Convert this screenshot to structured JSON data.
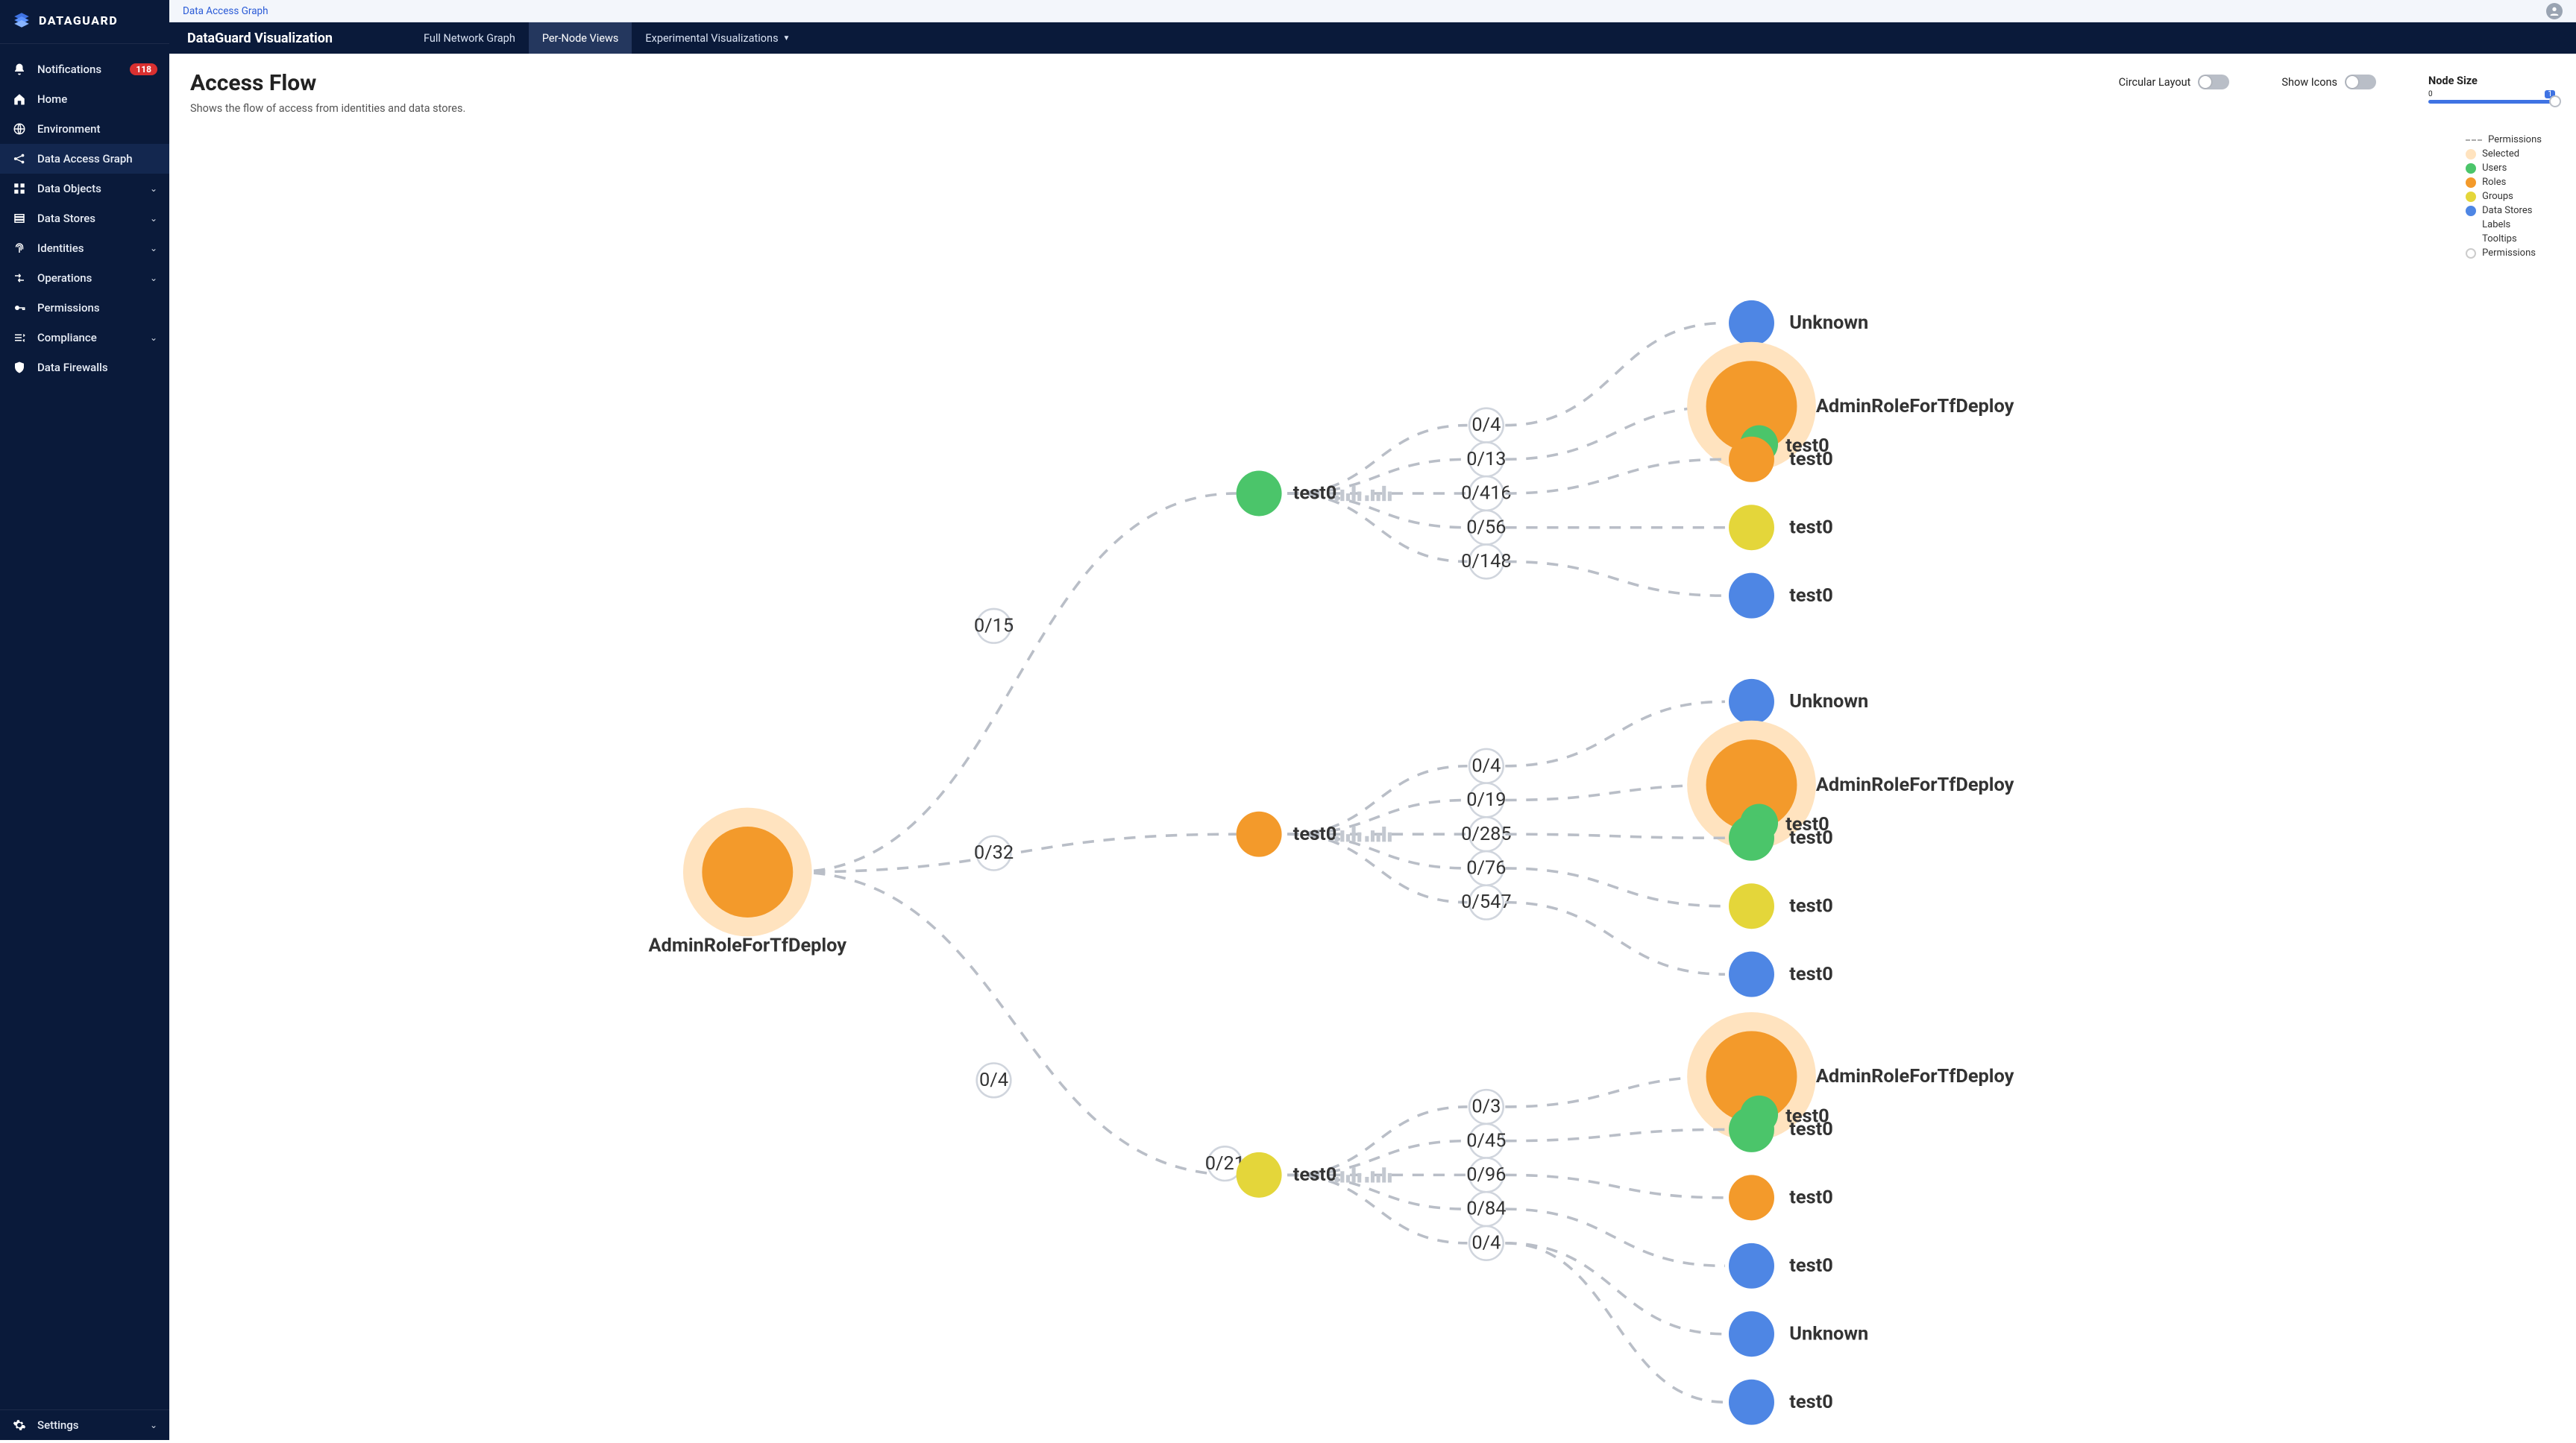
{
  "brand": {
    "name": "DATAGUARD"
  },
  "breadcrumb": {
    "label": "Data Access Graph"
  },
  "sidebar": {
    "items": [
      {
        "label": "Notifications",
        "icon": "bell",
        "badge": "118"
      },
      {
        "label": "Home",
        "icon": "home"
      },
      {
        "label": "Environment",
        "icon": "globe"
      },
      {
        "label": "Data Access Graph",
        "icon": "graph",
        "active": true
      },
      {
        "label": "Data Objects",
        "icon": "objects",
        "caret": true
      },
      {
        "label": "Data Stores",
        "icon": "stores",
        "caret": true
      },
      {
        "label": "Identities",
        "icon": "fingerprint",
        "caret": true
      },
      {
        "label": "Operations",
        "icon": "ops",
        "caret": true
      },
      {
        "label": "Permissions",
        "icon": "key"
      },
      {
        "label": "Compliance",
        "icon": "compliance",
        "caret": true
      },
      {
        "label": "Data Firewalls",
        "icon": "shield"
      }
    ],
    "bottom": {
      "label": "Settings",
      "icon": "gear",
      "caret": true
    }
  },
  "tabs": {
    "title": "DataGuard Visualization",
    "items": [
      {
        "label": "Full Network Graph"
      },
      {
        "label": "Per-Node Views",
        "active": true
      },
      {
        "label": "Experimental Visualizations",
        "caret": true
      }
    ]
  },
  "page": {
    "title": "Access Flow",
    "subtitle": "Shows the flow of access from identities and data stores."
  },
  "controls": {
    "circular": {
      "label": "Circular Layout",
      "on": false
    },
    "icons": {
      "label": "Show Icons",
      "on": false
    },
    "nodesize": {
      "label": "Node Size",
      "min": "0",
      "max": "1",
      "value": 1
    }
  },
  "legend": [
    {
      "label": "Permissions",
      "kind": "dash"
    },
    {
      "label": "Selected",
      "color": "#ffe3bf"
    },
    {
      "label": "Users",
      "color": "#4bc56a"
    },
    {
      "label": "Roles",
      "color": "#f39a2b"
    },
    {
      "label": "Groups",
      "color": "#e4d63a"
    },
    {
      "label": "Data Stores",
      "color": "#4e86e4"
    },
    {
      "label": "Labels",
      "kind": "text"
    },
    {
      "label": "Tooltips",
      "kind": "text"
    },
    {
      "label": "Permissions",
      "kind": "ring"
    }
  ],
  "colors": {
    "users": "#4bc56a",
    "roles": "#f39a2b",
    "groups": "#e4d63a",
    "datastores": "#4e86e4",
    "halo": "#ffe3bf"
  },
  "chart_data": {
    "type": "tree",
    "root": {
      "id": "root",
      "label": "AdminRoleForTfDeploy",
      "type": "roles",
      "selected": true
    },
    "root_edges": [
      {
        "label": "0/15",
        "to": "m1"
      },
      {
        "label": "0/32",
        "to": "m2"
      },
      {
        "label": "0/4",
        "to": "m3"
      }
    ],
    "mids": {
      "m1": {
        "label": "test0",
        "type": "users",
        "edges": [
          "0/4",
          "0/13",
          "0/416",
          "0/56",
          "0/148"
        ],
        "leaves": [
          {
            "label": "Unknown",
            "type": "datastores"
          },
          {
            "label": "AdminRoleForTfDeploy",
            "type": "roles",
            "selected": true,
            "overlay": "test0"
          },
          {
            "label": "test0",
            "type": "roles"
          },
          {
            "label": "test0",
            "type": "groups"
          },
          {
            "label": "test0",
            "type": "datastores"
          }
        ]
      },
      "m2": {
        "label": "test0",
        "type": "roles",
        "edges": [
          "0/4",
          "0/19",
          "0/285",
          "0/76",
          "0/547"
        ],
        "leaves": [
          {
            "label": "Unknown",
            "type": "datastores"
          },
          {
            "label": "AdminRoleForTfDeploy",
            "type": "roles",
            "selected": true,
            "overlay": "test0"
          },
          {
            "label": "test0",
            "type": "users"
          },
          {
            "label": "test0",
            "type": "groups"
          },
          {
            "label": "test0",
            "type": "datastores"
          }
        ]
      },
      "m3": {
        "label": "test0",
        "type": "groups",
        "edge_in_label": "0/21",
        "edges": [
          "0/3",
          "0/45",
          "0/96",
          "0/84",
          "0/4"
        ],
        "leaves": [
          {
            "label": "AdminRoleForTfDeploy",
            "type": "roles",
            "selected": true,
            "overlay": "test0"
          },
          {
            "label": "test0",
            "type": "users"
          },
          {
            "label": "test0",
            "type": "roles"
          },
          {
            "label": "test0",
            "type": "datastores"
          },
          {
            "label": "Unknown",
            "type": "datastores"
          },
          {
            "label": "test0",
            "type": "datastores"
          }
        ]
      }
    }
  }
}
